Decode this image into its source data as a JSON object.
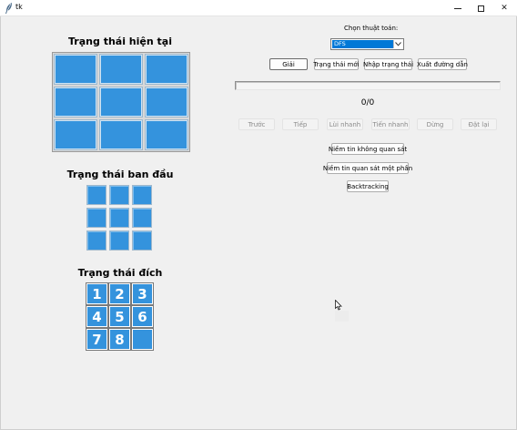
{
  "window": {
    "title": "tk",
    "icon": "feather-icon"
  },
  "left": {
    "current_title": "Trạng thái hiện tại",
    "current_tiles": [
      "",
      "",
      "",
      "",
      "",
      "",
      "",
      "",
      ""
    ],
    "initial_title": "Trạng thái ban đầu",
    "initial_tiles": [
      "",
      "",
      "",
      "",
      "",
      "",
      "",
      "",
      ""
    ],
    "goal_title": "Trạng thái đích",
    "goal_tiles": [
      "1",
      "2",
      "3",
      "4",
      "5",
      "6",
      "7",
      "8",
      ""
    ]
  },
  "controls": {
    "algo_label": "Chọn thuật toán:",
    "algo_selected": "DFS",
    "solve": "Giải",
    "new_state": "Trạng thái mới",
    "input_state": "Nhập trạng thái",
    "export_path": "Xuất đường dẫn",
    "progress_percent": 0,
    "step_counter": "0/0",
    "prev": "Trước",
    "next": "Tiếp",
    "rewind": "Lùi nhanh",
    "fast_forward": "Tiến nhanh",
    "stop": "Dừng",
    "reset": "Đặt lại",
    "belief_unobserved": "Niềm tin không quan sát",
    "belief_partial": "Niềm tin quan sát một phần",
    "backtracking": "Backtracking"
  },
  "colors": {
    "tile": "#3493dd",
    "selection": "#0078d7"
  }
}
